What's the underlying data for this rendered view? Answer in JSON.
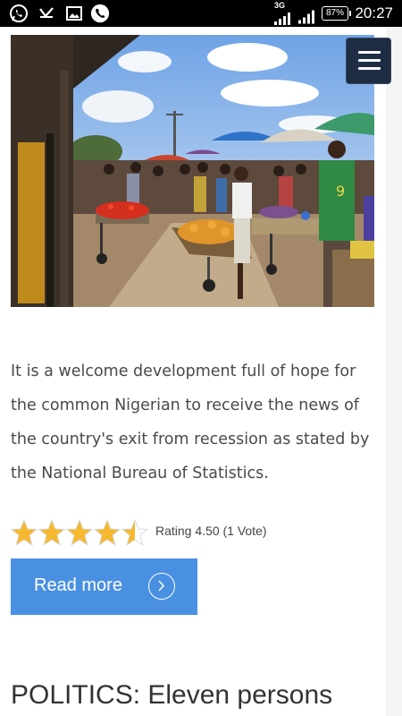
{
  "status_bar": {
    "time": "20:27",
    "battery": "87%",
    "network": "3G",
    "icons": [
      "whatsapp-icon",
      "missed-call-icon",
      "gallery-icon",
      "phone-icon",
      "signal-icon",
      "signal-icon",
      "battery-icon"
    ]
  },
  "menu": {
    "icon": "hamburger-menu-icon"
  },
  "article": {
    "excerpt": "It is a welcome development full of hope for the common Nigerian to receive the news of the country's exit from recession as stated by the National Bureau of Statistics.",
    "rating_value": 4.5,
    "rating_max": 5,
    "rating_text": "Rating 4.50 (1 Vote)",
    "read_more_label": "Read more",
    "read_more_icon": "chevron-right-circle-icon"
  },
  "next_article": {
    "title": "POLITICS: Eleven persons"
  },
  "colors": {
    "accent": "#4a90e2",
    "menu_bg": "#1e2d44",
    "star": "#f5b82e",
    "text": "#4a4a4a"
  }
}
